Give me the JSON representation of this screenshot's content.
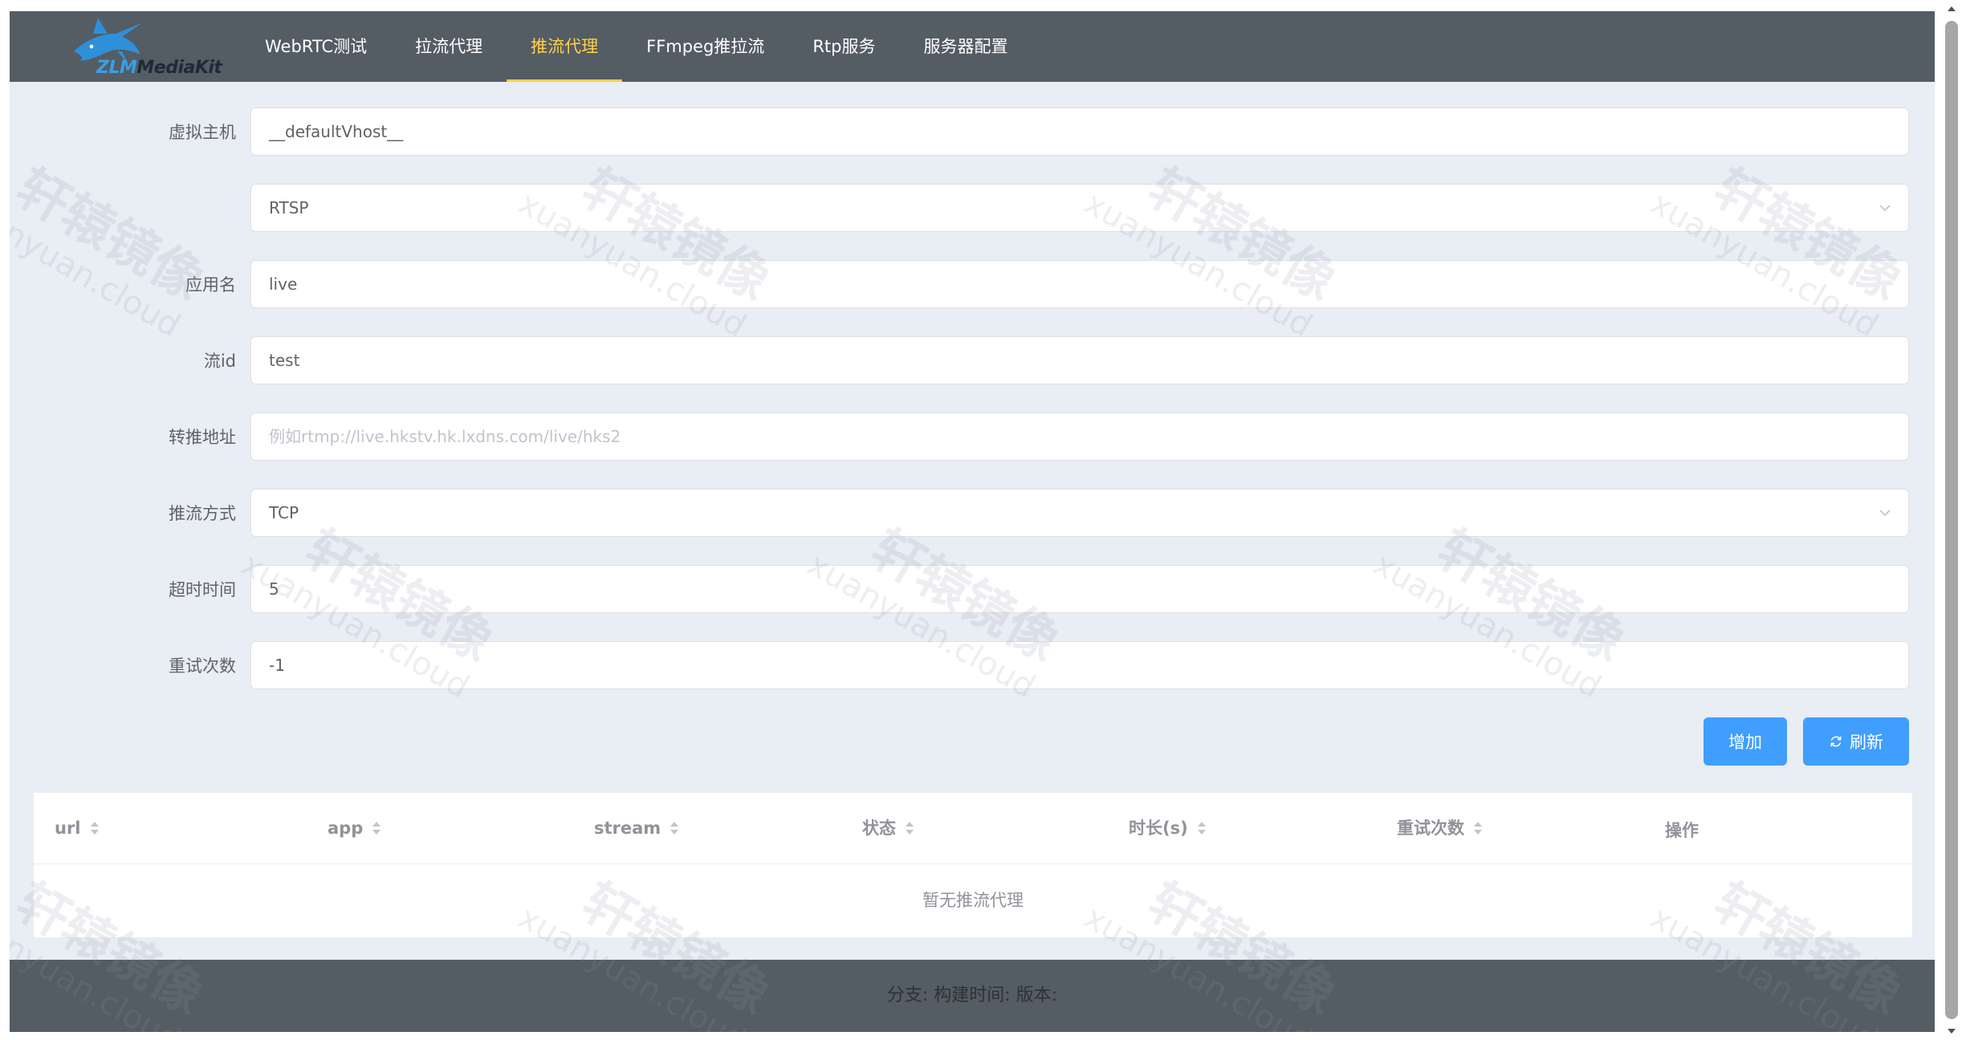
{
  "header": {
    "logo_text_prefix": "ZLM",
    "logo_text_suffix": "ediaKit",
    "nav": [
      {
        "label": "WebRTC测试",
        "active": false
      },
      {
        "label": "拉流代理",
        "active": false
      },
      {
        "label": "推流代理",
        "active": true
      },
      {
        "label": "FFmpeg推拉流",
        "active": false
      },
      {
        "label": "Rtp服务",
        "active": false
      },
      {
        "label": "服务器配置",
        "active": false
      }
    ]
  },
  "form": {
    "vhost": {
      "label": "虚拟主机",
      "value": "__defaultVhost__"
    },
    "schema": {
      "label": "",
      "value": "RTSP"
    },
    "app": {
      "label": "应用名",
      "value": "live"
    },
    "stream": {
      "label": "流id",
      "value": "test"
    },
    "dst_url": {
      "label": "转推地址",
      "value": "",
      "placeholder": "例如rtmp://live.hkstv.hk.lxdns.com/live/hks2"
    },
    "rtp_type": {
      "label": "推流方式",
      "value": "TCP"
    },
    "timeout": {
      "label": "超时时间",
      "value": "5"
    },
    "retry": {
      "label": "重试次数",
      "value": "-1"
    }
  },
  "buttons": {
    "add": "增加",
    "refresh": "刷新"
  },
  "table": {
    "columns": [
      "url",
      "app",
      "stream",
      "状态",
      "时长(s)",
      "重试次数",
      "操作"
    ],
    "empty_text": "暂无推流代理"
  },
  "footer": {
    "text": "分支:   构建时间: 版本:"
  },
  "watermark": {
    "cn": "轩辕镜像",
    "en": "xuanyuan.cloud"
  },
  "colors": {
    "header_bg": "#545c64",
    "active_nav": "#ffd04b",
    "primary": "#409eff",
    "page_bg": "#e9edf4"
  }
}
